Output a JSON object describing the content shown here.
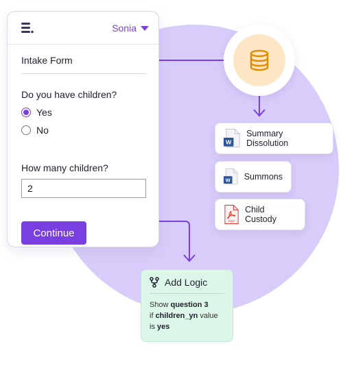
{
  "header": {
    "user_name": "Sonia"
  },
  "form": {
    "title": "Intake Form",
    "question_children": "Do you have children?",
    "options": [
      "Yes",
      "No"
    ],
    "selected_option": "Yes",
    "question_count": "How many children?",
    "count_value": "2",
    "continue_label": "Continue"
  },
  "documents": [
    {
      "label": "Summary Dissolution",
      "type": "word"
    },
    {
      "label": "Summons",
      "type": "word"
    },
    {
      "label": "Child Custody",
      "type": "pdf"
    }
  ],
  "icons": {
    "word_badge": "W",
    "pdf_badge": "PDF"
  },
  "logic": {
    "title": "Add Logic",
    "show": "Show",
    "question_ref": "question 3",
    "if": "if",
    "variable": "children_yn",
    "value_word": "value",
    "is": "is",
    "answer": "yes"
  },
  "colors": {
    "accent": "#7a3fe0",
    "circle": "#d8cdfa",
    "database": "#e58a00",
    "database_bg": "#fde6c4",
    "logic_bg": "#dcf7e8",
    "word_blue": "#2b579a",
    "pdf_red": "#d93025"
  }
}
